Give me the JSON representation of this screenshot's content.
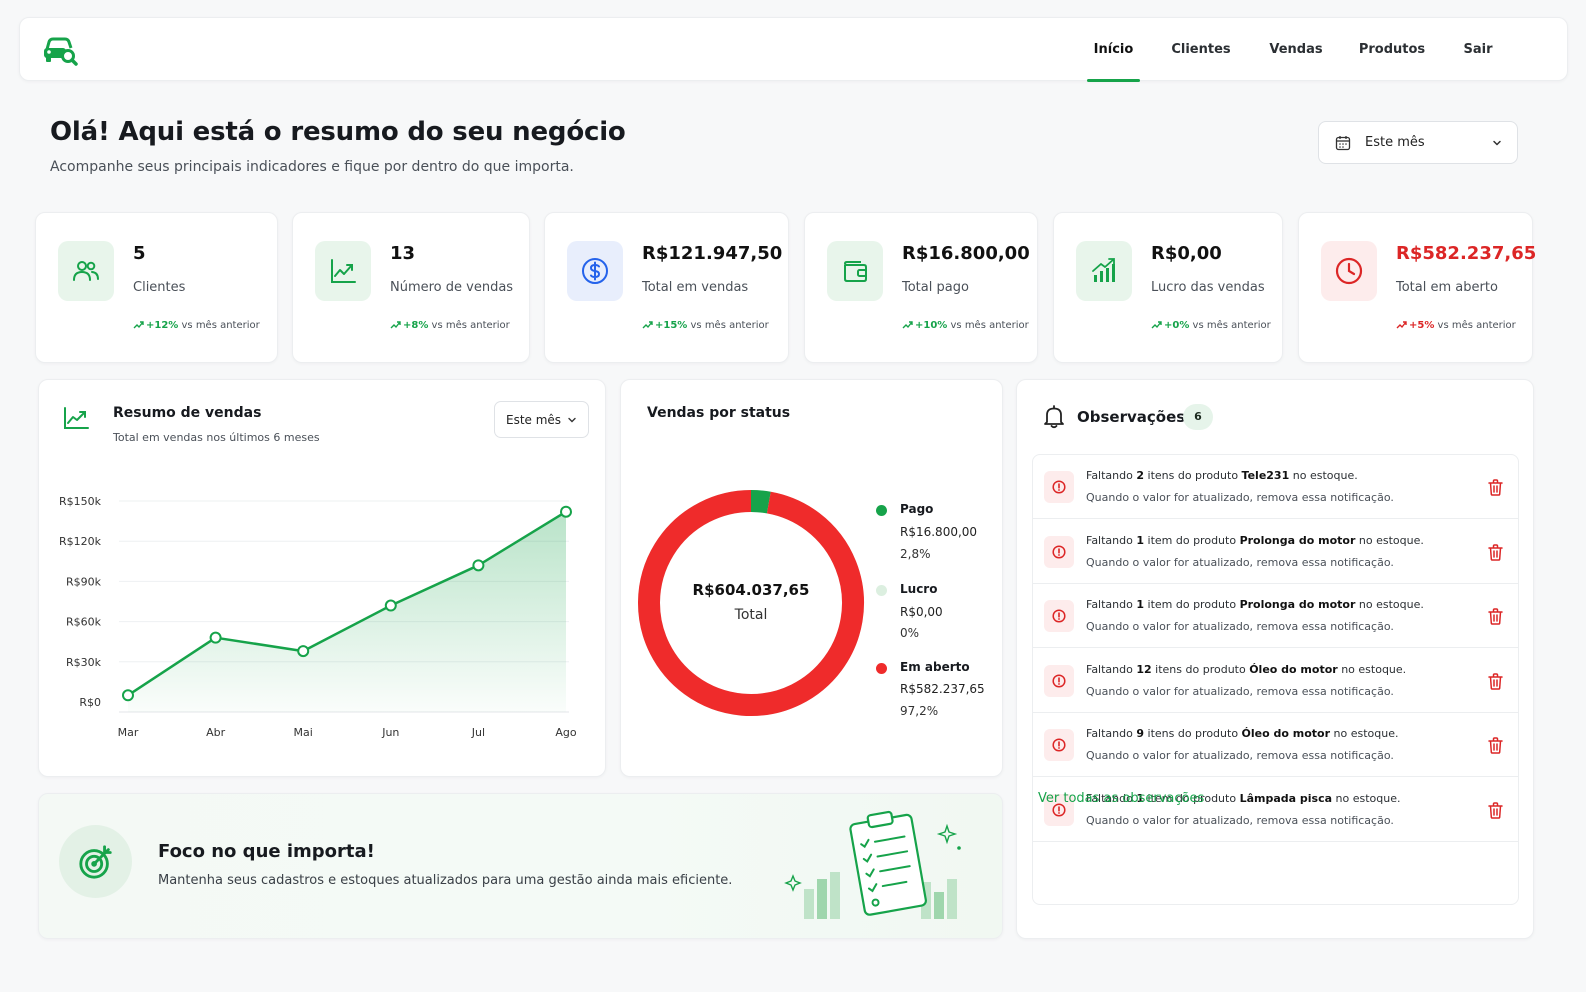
{
  "nav": {
    "items": [
      "Início",
      "Clientes",
      "Vendas",
      "Produtos",
      "Sair"
    ],
    "active": "Início"
  },
  "header": {
    "title": "Olá! Aqui está o resumo do seu negócio",
    "subtitle": "Acompanhe seus principais indicadores e fique por dentro do que importa.",
    "period": "Este mês"
  },
  "kpis": [
    {
      "value": "5",
      "label": "Clientes",
      "trend": "+12%",
      "trend_suffix": " vs mês anterior",
      "icon": "users-icon",
      "color": "#16a34a"
    },
    {
      "value": "13",
      "label": "Número de vendas",
      "trend": "+8%",
      "trend_suffix": " vs mês anterior",
      "icon": "trend-chart-icon",
      "color": "#16a34a"
    },
    {
      "value": "R$121.947,50",
      "label": "Total em vendas",
      "trend": "+15%",
      "trend_suffix": " vs mês anterior",
      "icon": "dollar-icon",
      "color": "#2563eb"
    },
    {
      "value": "R$16.800,00",
      "label": "Total pago",
      "trend": "+10%",
      "trend_suffix": " vs mês anterior",
      "icon": "wallet-icon",
      "color": "#16a34a"
    },
    {
      "value": "R$0,00",
      "label": "Lucro das vendas",
      "trend": "+0%",
      "trend_suffix": " vs mês anterior",
      "icon": "bar-growth-icon",
      "color": "#16a34a"
    },
    {
      "value": "R$582.237,65",
      "label": "Total em aberto",
      "trend": "+5%",
      "trend_suffix": " vs mês anterior",
      "icon": "clock-icon",
      "color": "#dc2626"
    }
  ],
  "sales": {
    "title": "Resumo de vendas",
    "subtitle": "Total em vendas nos últimos 6 meses",
    "period": "Este mês"
  },
  "chart_data": {
    "type": "area",
    "categories": [
      "Mar",
      "Abr",
      "Mai",
      "Jun",
      "Jul",
      "Ago"
    ],
    "values": [
      5000,
      48000,
      38000,
      72000,
      102000,
      142000
    ],
    "y_ticks": [
      "R$0",
      "R$30k",
      "R$60k",
      "R$90k",
      "R$120k",
      "R$150k"
    ],
    "ylim": [
      0,
      150000
    ],
    "line_color": "#16a34a",
    "grid": true
  },
  "status": {
    "title": "Vendas por status",
    "total_value": "R$604.037,65",
    "total_label": "Total",
    "slices": [
      {
        "name": "Pago",
        "value": "R$16.800,00",
        "pct": "2,8%",
        "fraction": 0.028,
        "color": "#16a34a"
      },
      {
        "name": "Lucro",
        "value": "R$0,00",
        "pct": "0%",
        "fraction": 0.0,
        "color": "#dcefe0"
      },
      {
        "name": "Em aberto",
        "value": "R$582.237,65",
        "pct": "97,2%",
        "fraction": 0.972,
        "color": "#ef2b2b"
      }
    ]
  },
  "observations": {
    "title": "Observações",
    "count": "6",
    "hint": "Quando o valor for atualizado, remova essa notificação.",
    "items": [
      {
        "pre": "Faltando ",
        "qty": "2",
        "mid": " itens do produto ",
        "product": "Tele231",
        "post": " no estoque."
      },
      {
        "pre": "Faltando ",
        "qty": "1",
        "mid": " item do produto ",
        "product": "Prolonga do motor",
        "post": " no estoque."
      },
      {
        "pre": "Faltando ",
        "qty": "1",
        "mid": " item do produto ",
        "product": "Prolonga do motor",
        "post": " no estoque."
      },
      {
        "pre": "Faltando ",
        "qty": "12",
        "mid": " itens do produto ",
        "product": "Óleo do motor",
        "post": " no estoque."
      },
      {
        "pre": "Faltando ",
        "qty": "9",
        "mid": " itens do produto ",
        "product": "Óleo do motor",
        "post": " no estoque."
      },
      {
        "pre": "Faltando ",
        "qty": "1",
        "mid": " item do produto ",
        "product": "Lâmpada pisca",
        "post": " no estoque."
      }
    ],
    "link": "Ver todas as observações"
  },
  "focus": {
    "title": "Foco no que importa!",
    "subtitle": "Mantenha seus cadastros e estoques atualizados para uma gestão ainda mais eficiente."
  },
  "colors": {
    "brand": "#16a34a",
    "danger": "#dc2626",
    "blue": "#2563eb"
  }
}
